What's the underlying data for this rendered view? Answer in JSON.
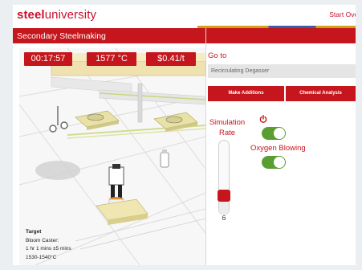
{
  "header": {
    "logo_bold": "steel",
    "logo_rest": "university",
    "start_over": "Start Over"
  },
  "titlebar": {
    "title": "Secondary Steelmaking"
  },
  "scene": {
    "timer": "00:17:57",
    "temperature": "1577 °C",
    "cost": "$0.41/t",
    "target": {
      "heading": "Target",
      "destination": "Bloom Caster:",
      "time": "1 hr 1 mins ±5 mins",
      "temp_range": "1530-1540°C"
    }
  },
  "panel": {
    "goto_label": "Go to",
    "goto_value": "Recirculating Degasser",
    "make_additions": "Make Additions",
    "chemical_analysis": "Chemical Analysis",
    "simulation_rate_label": "Simulation Rate",
    "simulation_rate_value": "6",
    "power_on": true,
    "oxygen_label": "Oxygen Blowing",
    "oxygen_on": true
  },
  "colors": {
    "brand_red": "#c4161c",
    "toggle_green": "#5a9e32"
  }
}
